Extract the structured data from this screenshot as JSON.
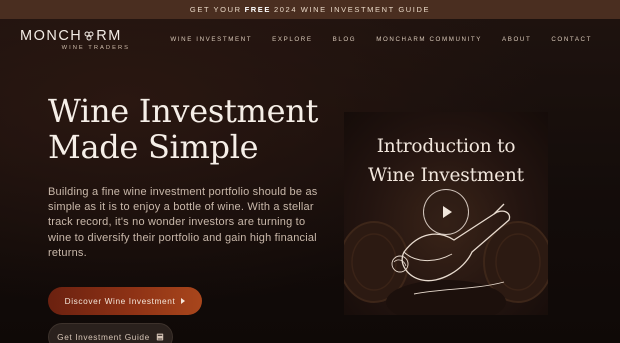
{
  "promo": {
    "prefix": "GET YOUR",
    "highlight": "FREE",
    "suffix": "2024 WINE INVESTMENT GUIDE"
  },
  "brand": {
    "name_part1": "MONCH",
    "name_part2": "RM",
    "subtitle": "WINE TRADERS",
    "mark_icon": "grape-cluster-icon"
  },
  "nav": {
    "items": [
      {
        "label": "WINE INVESTMENT"
      },
      {
        "label": "EXPLORE"
      },
      {
        "label": "BLOG"
      },
      {
        "label": "MONCHARM COMMUNITY"
      },
      {
        "label": "ABOUT"
      },
      {
        "label": "CONTACT"
      }
    ]
  },
  "hero": {
    "title_line1": "Wine Investment",
    "title_line2": "Made Simple",
    "text": "Building a fine wine investment portfolio should be as simple as it is to enjoy a bottle of wine. With a stellar track record, it's no wonder investors are turning to wine to diversify their portfolio and gain high financial returns.",
    "primary_button": {
      "label": "Discover Wine Investment",
      "icon": "play-triangle-icon"
    },
    "secondary_button": {
      "label": "Get Investment Guide",
      "icon": "book-icon"
    }
  },
  "video": {
    "title_line1": "Introduction to",
    "title_line2": "Wine Investment",
    "play_icon": "play-icon"
  },
  "colors": {
    "promo_bg": "#4a2e20",
    "page_bg": "#120b09",
    "accent_button": "#8e3215",
    "secondary_button": "#2a211d",
    "text_light": "#f6efe8"
  }
}
